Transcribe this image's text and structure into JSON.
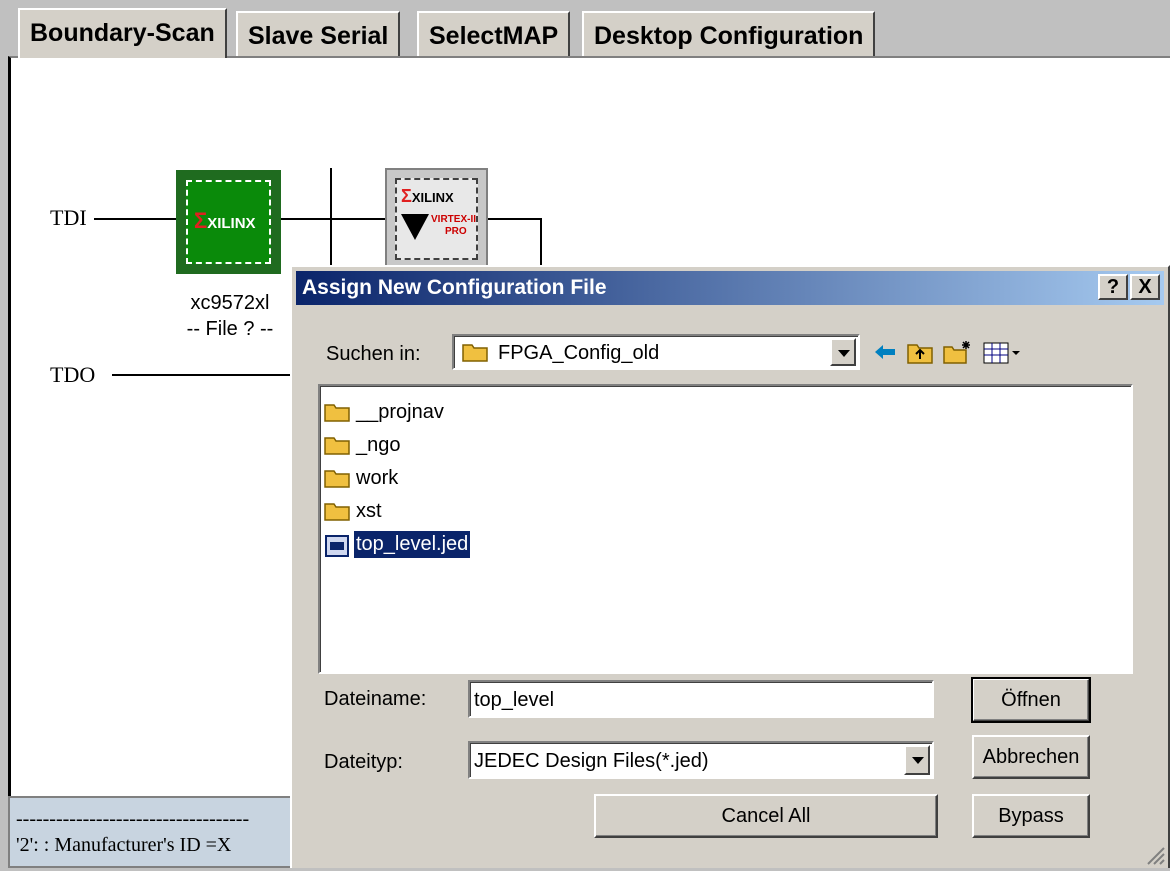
{
  "tabs": [
    {
      "label": "Boundary-Scan"
    },
    {
      "label": "Slave Serial"
    },
    {
      "label": "SelectMAP"
    },
    {
      "label": "Desktop Configuration"
    }
  ],
  "chain": {
    "tdi_label": "TDI",
    "tdo_label": "TDO",
    "device1": {
      "logo": "XILINX",
      "name": "xc9572xl",
      "file": "-- File ? --"
    },
    "device2": {
      "logo": "XILINX",
      "family_line1": "VIRTEX-II",
      "family_line2": "PRO"
    }
  },
  "log": {
    "separator": "-----------------------------------",
    "line": "'2': : Manufacturer's ID =X"
  },
  "dialog": {
    "title": "Assign New Configuration File",
    "help_button": "?",
    "close_button": "X",
    "look_in_label": "Suchen in:",
    "look_in_value": "FPGA_Config_old",
    "files": [
      {
        "name": "__projnav",
        "type": "folder"
      },
      {
        "name": "_ngo",
        "type": "folder"
      },
      {
        "name": "work",
        "type": "folder"
      },
      {
        "name": "xst",
        "type": "folder"
      },
      {
        "name": "top_level.jed",
        "type": "file",
        "selected": true
      }
    ],
    "filename_label": "Dateiname:",
    "filename_value": "top_level",
    "filetype_label": "Dateityp:",
    "filetype_value": "JEDEC Design Files(*.jed)",
    "open_button": "Öffnen",
    "cancel_button": "Abbrechen",
    "cancel_all_button": "Cancel All",
    "bypass_button": "Bypass"
  }
}
